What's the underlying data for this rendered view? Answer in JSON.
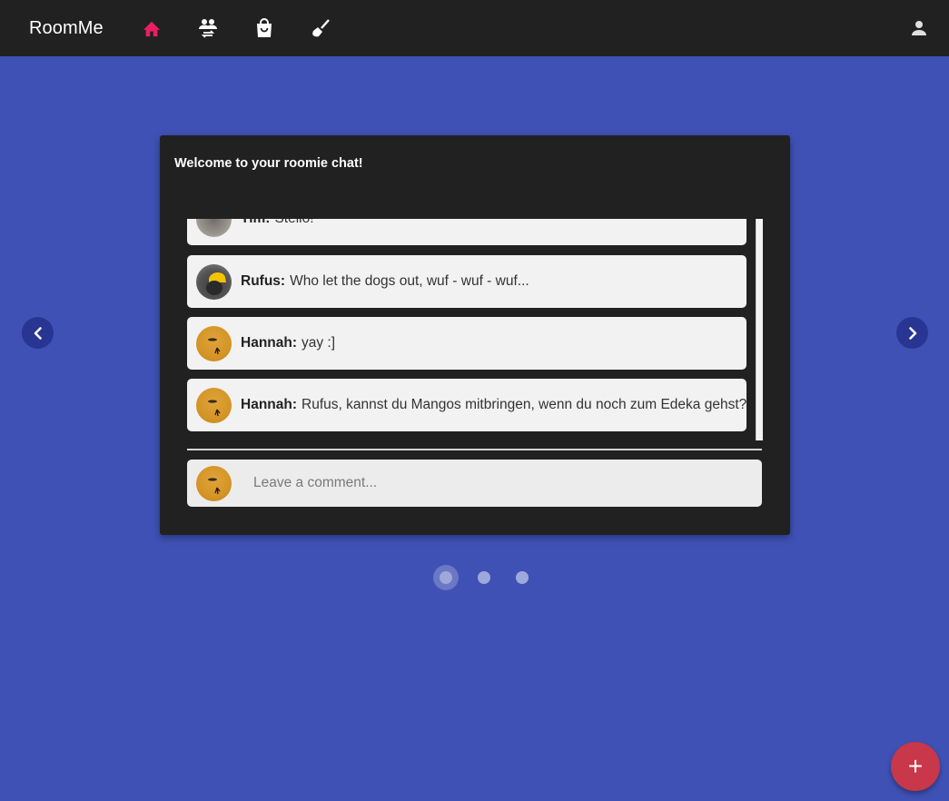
{
  "app": {
    "brand": "RoomMe"
  },
  "nav": [
    {
      "name": "home",
      "icon": "home-icon",
      "active": true
    },
    {
      "name": "roommates",
      "icon": "people-swap-icon",
      "active": false
    },
    {
      "name": "shopping",
      "icon": "shopping-bag-icon",
      "active": false
    },
    {
      "name": "cleaning",
      "icon": "broom-icon",
      "active": false
    }
  ],
  "profile": {
    "icon": "person-icon"
  },
  "colors": {
    "accent": "#e91e63",
    "primary": "#3f51b5",
    "appbar": "#212121",
    "fab": "#c8374a"
  },
  "chat": {
    "title": "Welcome to your roomie chat!",
    "messages": [
      {
        "author": "Tim:",
        "text": "Stello!",
        "avatar": "tim"
      },
      {
        "author": "Rufus:",
        "text": "Who let the dogs out, wuf - wuf - wuf...",
        "avatar": "rufus"
      },
      {
        "author": "Hannah:",
        "text": "yay :]",
        "avatar": "hannah"
      },
      {
        "author": "Hannah:",
        "text": "Rufus, kannst du Mangos mitbringen, wenn du noch zum Edeka gehst?",
        "avatar": "hannah"
      }
    ],
    "comment_placeholder": "Leave a comment..."
  },
  "carousel": {
    "pages": 3,
    "active_page": 1
  },
  "fab": {
    "label": "+"
  }
}
